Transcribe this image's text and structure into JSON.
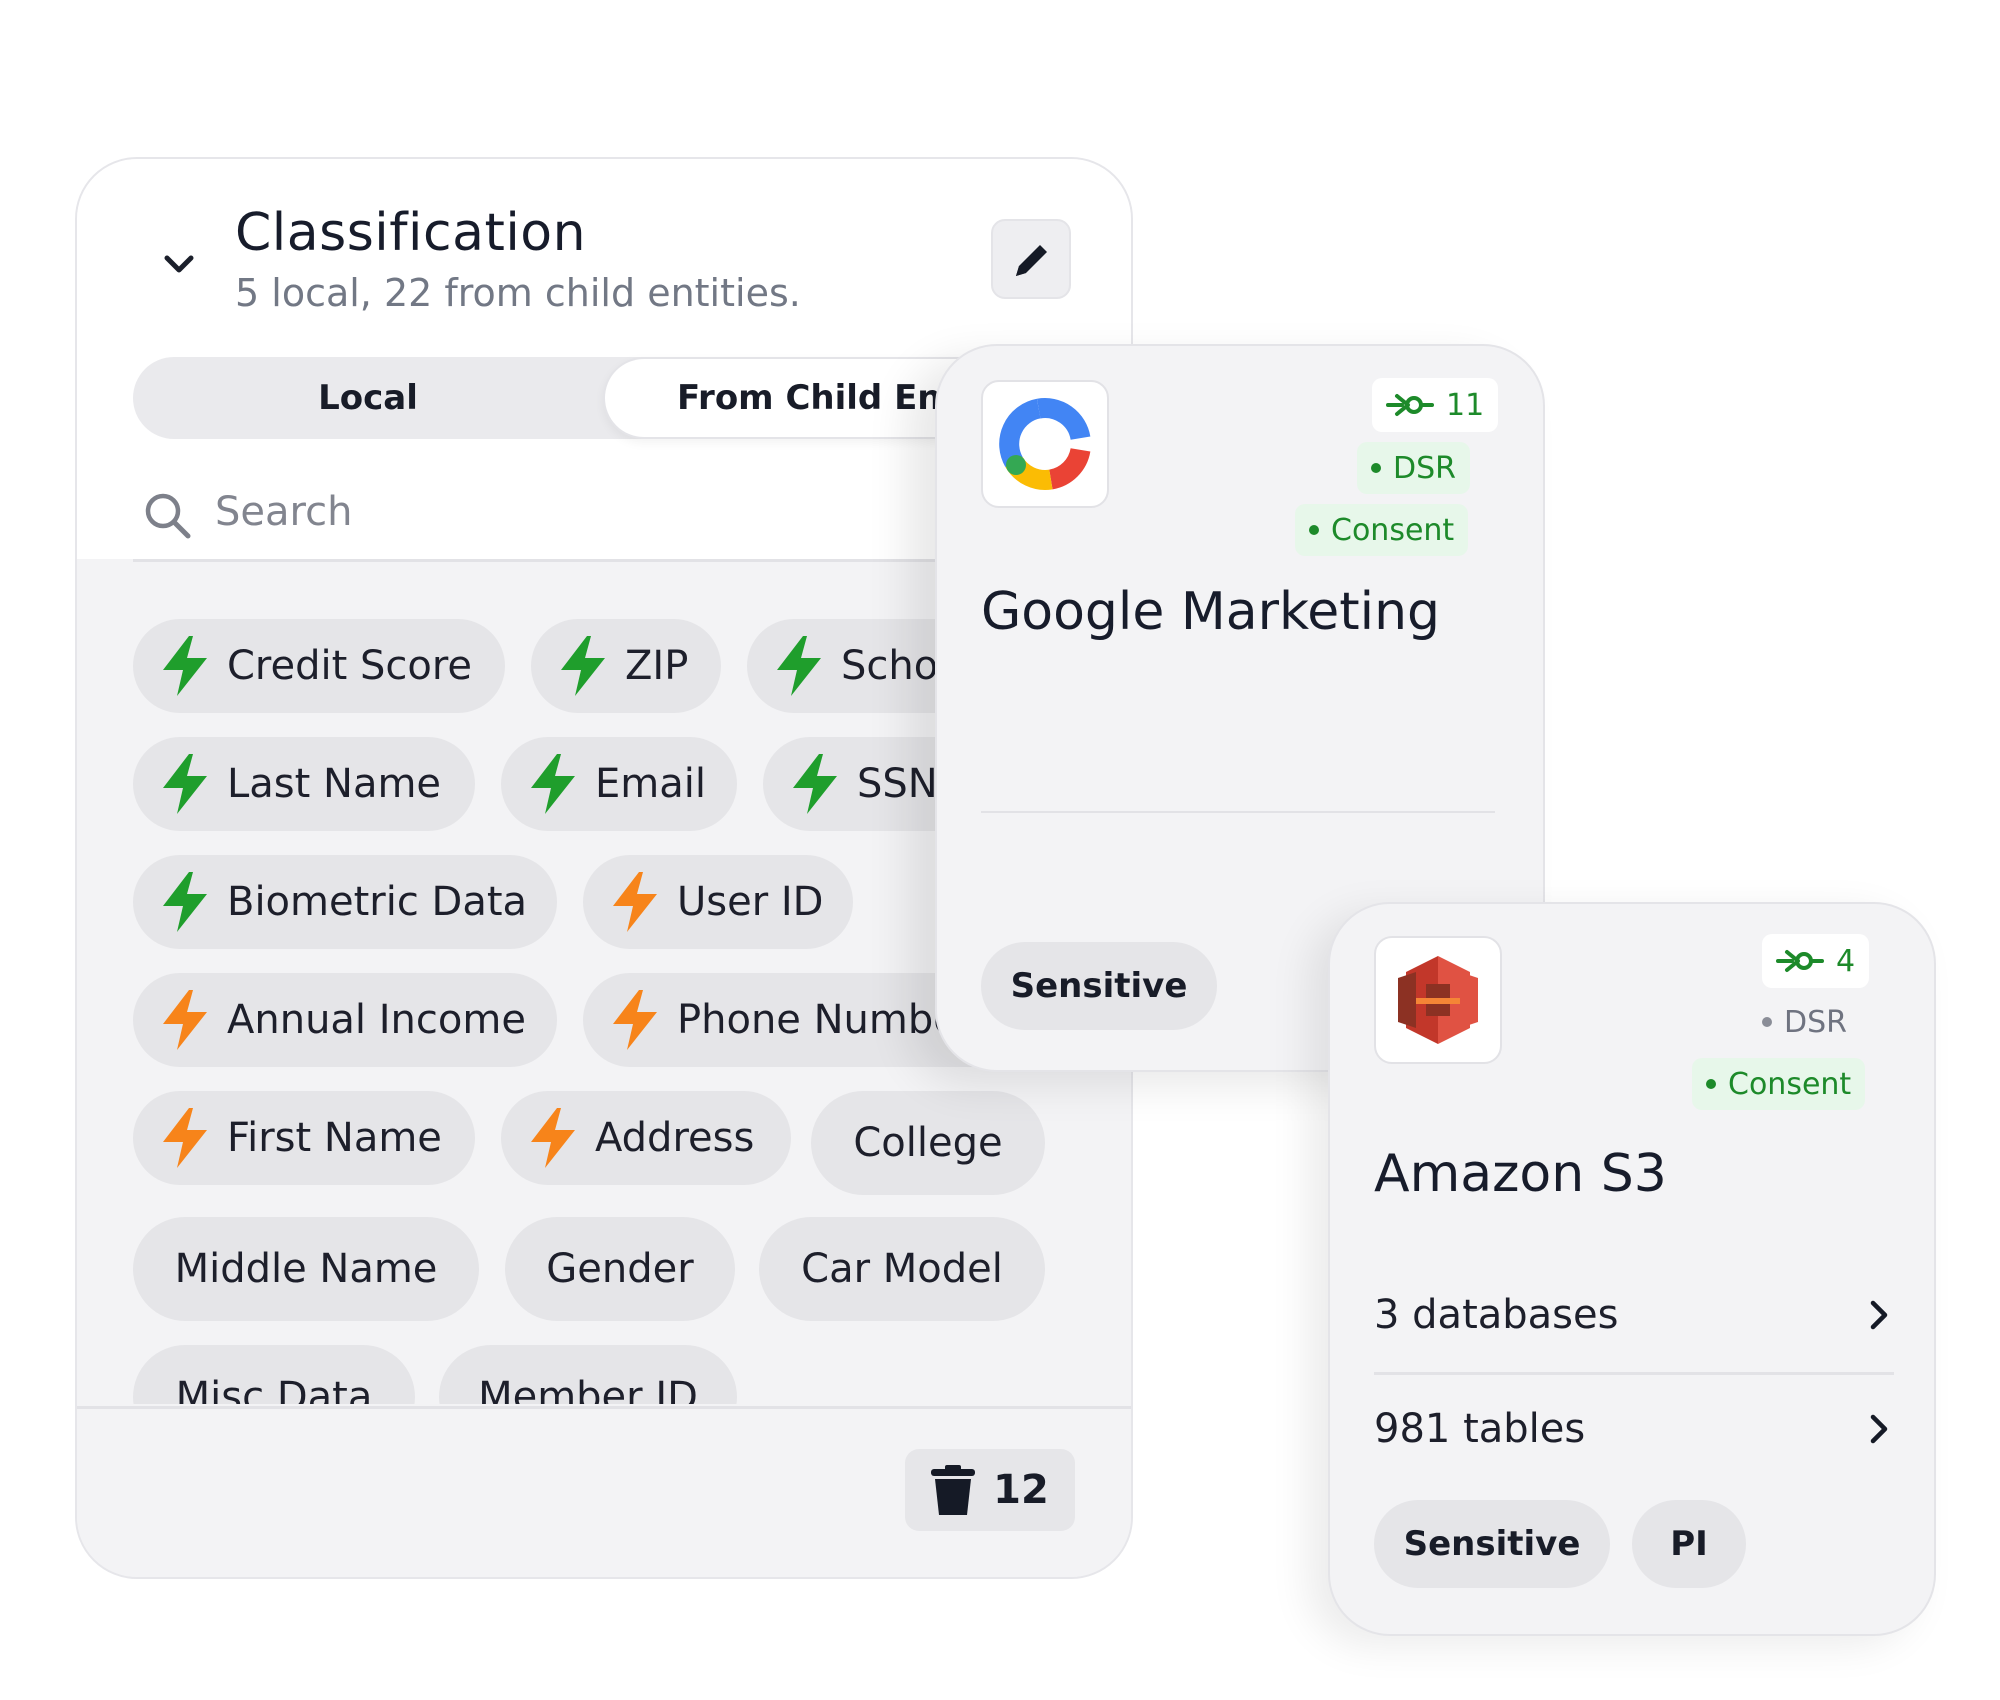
{
  "classification": {
    "title": "Classification",
    "subtitle": "5 local, 22 from child entities.",
    "tabs": [
      "Local",
      "From Child Enti"
    ],
    "search_placeholder": "Search",
    "tags": [
      {
        "label": "Credit Score",
        "icon": "bolt-green-icon"
      },
      {
        "label": "ZIP",
        "icon": "bolt-green-icon"
      },
      {
        "label": "Scho",
        "icon": "bolt-green-icon"
      },
      {
        "label": "Last Name",
        "icon": "bolt-green-icon"
      },
      {
        "label": "Email",
        "icon": "bolt-green-icon"
      },
      {
        "label": "SSN",
        "icon": "bolt-green-icon"
      },
      {
        "label": "Biometric Data",
        "icon": "bolt-green-icon"
      },
      {
        "label": "User ID",
        "icon": "bolt-orange-icon"
      },
      {
        "label": "Annual Income",
        "icon": "bolt-orange-icon"
      },
      {
        "label": "Phone Numbe",
        "icon": "bolt-orange-icon"
      },
      {
        "label": "First Name",
        "icon": "bolt-orange-icon"
      },
      {
        "label": "Address",
        "icon": "bolt-orange-icon"
      },
      {
        "label": "College",
        "icon": ""
      },
      {
        "label": "Middle Name",
        "icon": ""
      },
      {
        "label": "Gender",
        "icon": ""
      },
      {
        "label": "Car Model",
        "icon": ""
      },
      {
        "label": "Misc Data",
        "icon": ""
      },
      {
        "label": "Member ID",
        "icon": ""
      }
    ],
    "trash_count": "12"
  },
  "google_card": {
    "title": "Google Marketing",
    "connections": "11",
    "badges": [
      "DSR",
      "Consent"
    ],
    "tags": [
      "Sensitive"
    ]
  },
  "amazon_card": {
    "title": "Amazon S3",
    "connections": "4",
    "badges": [
      "DSR",
      "Consent"
    ],
    "rows": [
      "3 databases",
      "981 tables"
    ],
    "tags": [
      "Sensitive",
      "PI"
    ]
  },
  "colors": {
    "green": "#1f9e2c",
    "orange": "#f7841a",
    "badge_bg": "#e7f7ea",
    "card_bg": "#f3f3f5"
  }
}
